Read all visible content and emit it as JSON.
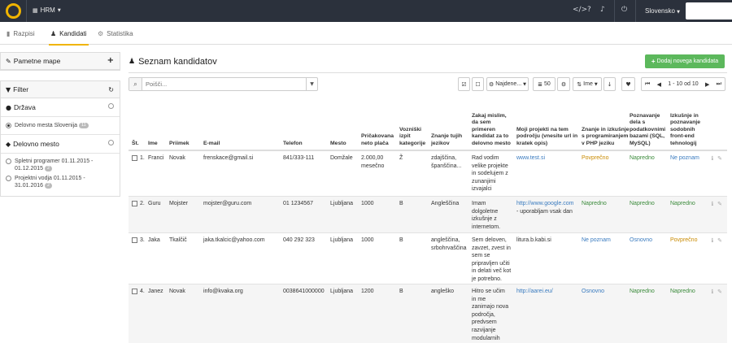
{
  "topbar": {
    "app_name": "HRM",
    "language": "Slovensko"
  },
  "tabs": [
    {
      "label": "Razpisi"
    },
    {
      "label": "Kandidati"
    },
    {
      "label": "Statistika"
    }
  ],
  "sidebar": {
    "saved_maps_label": "Pametne mape",
    "filter_label": "Filter",
    "drzava_label": "Država",
    "drzava_option": "Delovno mesta Slovenija",
    "drzava_option_count": "11",
    "mesto_label": "Delovno mesto",
    "mesto_options": [
      {
        "line1": "Spletni programer 01.11.2015 -",
        "line2": "01.12.2015",
        "count": "2"
      },
      {
        "line1": "Projektni vodja 01.11.2015 -",
        "line2": "31.01.2016",
        "count": "2"
      }
    ]
  },
  "main": {
    "title": "Seznam kandidatov",
    "add_button": "Dodaj novega kandidata",
    "search_placeholder": "Poišči...",
    "found_label": "Najdene...",
    "page_size": "50",
    "sort_label": "Ime",
    "pagination": "1 - 10 od 10"
  },
  "table": {
    "headers": {
      "st": "Št.",
      "ime": "Ime",
      "priimek": "Priimek",
      "email": "E-mail",
      "telefon": "Telefon",
      "mesto": "Mesto",
      "placa": "Pričakovana neto plača",
      "izpit": "Vozniški izpit kategorije",
      "jeziki": "Znanje tujih jezikov",
      "zakaj": "Zakaj mislim, da sem primeren kandidat za to delovno mesto",
      "projekti": "Moji projekti na tem področju (vnesite url in kratek opis)",
      "php": "Znanje in izkušnje s programiranjem v PHP jeziku",
      "sql": "Poznavanje dela s podatkovnimi bazami (SQL, MySQL)",
      "frontend": "Izkušnje in poznavanje sodobnih front-end tehnologij"
    },
    "rows": [
      {
        "st": "1.",
        "ime": "Franci",
        "priimek": "Novak",
        "email": "frenskace@gmail.si",
        "telefon": "841/333-111",
        "mesto": "Domžale",
        "placa_1": "2.000,00",
        "placa_2": "mesečno",
        "izpit": "Ž",
        "jeziki_1": "zdajščina,",
        "jeziki_2": "španščina...",
        "zakaj": [
          "Rad vodim",
          "velike projekte",
          "in sodelujem z",
          "zunanjimi",
          "izvajalci"
        ],
        "projekti": [
          "www.test.si"
        ],
        "php": "Povprečno",
        "sql": "Napredno",
        "frontend": "Ne poznam"
      },
      {
        "st": "2.",
        "ime": "Guru",
        "priimek": "Mojster",
        "email": "mojster@guru.com",
        "telefon": "01 1234567",
        "mesto": "Ljubljana",
        "placa_1": "1000",
        "placa_2": "",
        "izpit": "B",
        "jeziki_1": "Angleščina",
        "jeziki_2": "",
        "zakaj": [
          "Imam",
          "dolgoletne",
          "izkušnje z",
          "internetom."
        ],
        "projekti": [
          "http://www.google.com",
          "- uporabljam vsak dan"
        ],
        "php": "Napredno",
        "sql": "Napredno",
        "frontend": "Napredno"
      },
      {
        "st": "3.",
        "ime": "Jaka",
        "priimek": "Tkalčič",
        "email": "jaka.tkalcic@yahoo.com",
        "telefon": "040 292 323",
        "mesto": "Ljubljana",
        "placa_1": "1000",
        "placa_2": "",
        "izpit": "B",
        "jeziki_1": "angleščina,",
        "jeziki_2": "srbohrvaščina",
        "zakaj": [
          "Sem deloven,",
          "zavzet, zvest in",
          "sem se",
          "pripravljen učiti",
          "in delati več kot",
          "je potrebno."
        ],
        "projekti": [
          "litura.b.kabi.si"
        ],
        "php": "Ne poznam",
        "sql": "Osnovno",
        "frontend": "Povprečno"
      },
      {
        "st": "4.",
        "ime": "Janez",
        "priimek": "Novak",
        "email": "info@kvaka.org",
        "telefon": "0038641000000",
        "mesto": "Ljubljana",
        "placa_1": "1200",
        "placa_2": "",
        "izpit": "B",
        "jeziki_1": "angleško",
        "jeziki_2": "",
        "zakaj": [
          "Hitro se učim",
          "in me",
          "zanimajo nova",
          "področja,",
          "predvsem",
          "razvijanje",
          "modularnih"
        ],
        "projekti": [
          "http://aarei.eu/"
        ],
        "php": "Osnovno",
        "sql": "Napredno",
        "frontend": "Napredno"
      }
    ]
  }
}
